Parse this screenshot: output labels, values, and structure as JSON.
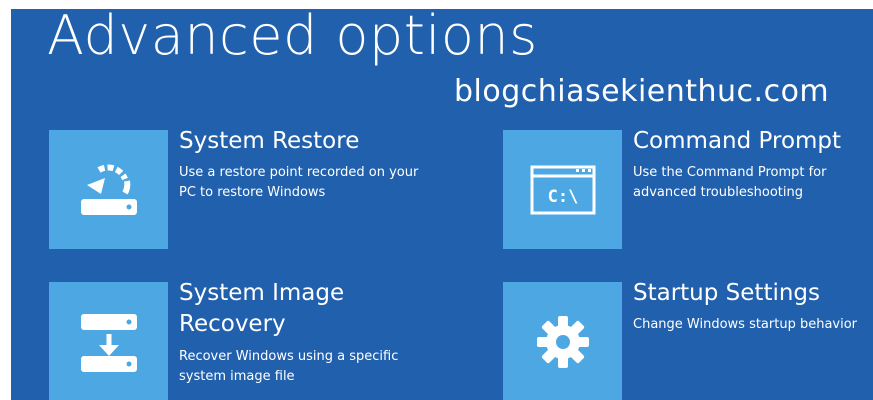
{
  "screen": {
    "title": "Advanced options",
    "watermark": "blogchiasekienthuc.com",
    "background_color": "#2160ad",
    "tile_color": "#4da7e3"
  },
  "options": [
    {
      "title_lines": [
        "System Restore"
      ],
      "description_lines": [
        "Use a restore point recorded on your",
        "PC to restore Windows"
      ],
      "icon": "system-restore-icon"
    },
    {
      "title_lines": [
        "Command Prompt"
      ],
      "description_lines": [
        "Use the Command Prompt for",
        "advanced troubleshooting"
      ],
      "icon": "command-prompt-icon",
      "icon_text": "C:\\"
    },
    {
      "title_lines": [
        "System Image",
        "Recovery"
      ],
      "description_lines": [
        "Recover Windows using a specific",
        "system image file"
      ],
      "icon": "system-image-recovery-icon"
    },
    {
      "title_lines": [
        "Startup Settings"
      ],
      "description_lines": [
        "Change Windows startup behavior"
      ],
      "icon": "gear-icon"
    }
  ]
}
